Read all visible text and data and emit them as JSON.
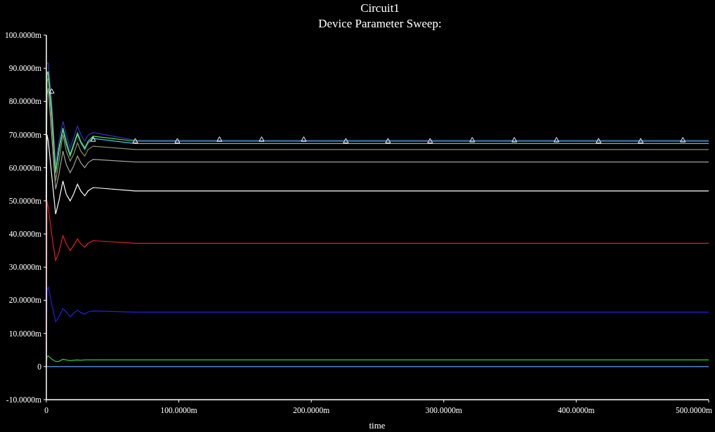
{
  "graph": {
    "circuit": "Circuit1",
    "chart_data": {
      "type": "line",
      "title": "Device Parameter Sweep:",
      "xlabel": "time",
      "x": [
        0,
        0.5,
        1.5,
        4,
        7,
        9.5,
        12.5,
        15,
        18,
        20.5,
        23.5,
        26,
        29,
        31.5,
        35.3,
        67.1,
        98.9,
        130.7,
        162.5,
        194.3,
        226.1,
        257.9,
        289.7,
        321.5,
        353.3,
        385.1,
        416.9,
        448.7,
        480.5,
        500
      ],
      "xlim": [
        0,
        500
      ],
      "ylim": [
        -10,
        100
      ],
      "xticks": [
        {
          "value": 0,
          "label": "0"
        },
        {
          "value": 100,
          "label": "100.0000m"
        },
        {
          "value": 200,
          "label": "200.0000m"
        },
        {
          "value": 300,
          "label": "300.0000m"
        },
        {
          "value": 400,
          "label": "400.0000m"
        },
        {
          "value": 500,
          "label": "500.0000m"
        }
      ],
      "yticks": [
        {
          "value": -10,
          "label": "-10.0000m"
        },
        {
          "value": 0,
          "label": "0"
        },
        {
          "value": 10,
          "label": "10.0000m"
        },
        {
          "value": 20,
          "label": "20.0000m"
        },
        {
          "value": 30,
          "label": "30.0000m"
        },
        {
          "value": 40,
          "label": "40.0000m"
        },
        {
          "value": 50,
          "label": "50.0000m"
        },
        {
          "value": 60,
          "label": "60.0000m"
        },
        {
          "value": 70,
          "label": "70.0000m"
        },
        {
          "value": 80,
          "label": "80.0000m"
        },
        {
          "value": 90,
          "label": "90.0000m"
        },
        {
          "value": 100,
          "label": "100.0000m"
        }
      ],
      "series": [
        {
          "color": "#60a0ff",
          "values": [
            0,
            0,
            0,
            0,
            0,
            0,
            0,
            0,
            0,
            0,
            0,
            0,
            0,
            0,
            0,
            0,
            0,
            0,
            0,
            0,
            0,
            0,
            0,
            0,
            0,
            0,
            0,
            0,
            0,
            0
          ]
        },
        {
          "color": "#30d030",
          "values": [
            0,
            3,
            3.2,
            2.3,
            1.5,
            1.6,
            2.2,
            2,
            1.8,
            1.9,
            2,
            1.9,
            2,
            2,
            2,
            2,
            2,
            2,
            2,
            2,
            2,
            2,
            2,
            2,
            2,
            2,
            2,
            2,
            2,
            2
          ]
        },
        {
          "color": "#2020e0",
          "values": [
            0,
            23,
            24,
            19,
            13.5,
            15,
            17.5,
            16.5,
            15,
            16,
            17,
            16.3,
            15.8,
            16.5,
            16.8,
            16.4,
            16.4,
            16.4,
            16.4,
            16.4,
            16.4,
            16.4,
            16.4,
            16.4,
            16.4,
            16.4,
            16.4,
            16.4,
            16.4,
            16.4
          ]
        },
        {
          "color": "#e02020",
          "values": [
            0,
            50,
            48,
            40,
            32,
            34.5,
            39.5,
            37,
            35,
            36.5,
            38.5,
            37,
            36,
            37.2,
            38,
            37.2,
            37.2,
            37.2,
            37.2,
            37.2,
            37.2,
            37.2,
            37.2,
            37.2,
            37.2,
            37.2,
            37.2,
            37.2,
            37.2,
            37.2
          ]
        },
        {
          "color": "#ffffff",
          "values": [
            50,
            70,
            68,
            58,
            46,
            50,
            56,
            52,
            50,
            52,
            55,
            53,
            51.5,
            53,
            54,
            53,
            53,
            53,
            53,
            53,
            53,
            53,
            53,
            53,
            53,
            53,
            53,
            53,
            53,
            53
          ]
        },
        {
          "color": "#a0a0a0",
          "values": [
            60,
            82,
            84,
            70,
            53.5,
            58,
            65,
            61,
            58.5,
            60.5,
            63.5,
            61.5,
            60,
            61.5,
            62.5,
            61.7,
            61.7,
            61.7,
            61.7,
            61.7,
            61.7,
            61.7,
            61.7,
            61.7,
            61.7,
            61.7,
            61.7,
            61.7,
            61.7,
            61.7
          ]
        },
        {
          "color": "#909050",
          "values": [
            65,
            86,
            87,
            74,
            56,
            62,
            70,
            65,
            62,
            64,
            67.5,
            65,
            63.5,
            65.5,
            66.5,
            65.5,
            65.5,
            65.5,
            65.5,
            65.5,
            65.5,
            65.5,
            65.5,
            65.5,
            65.5,
            65.5,
            65.5,
            65.5,
            65.5,
            65.5
          ]
        },
        {
          "color": "#40c8e8",
          "values": [
            null,
            89,
            88,
            77,
            58.5,
            65,
            71.5,
            67,
            63.5,
            66.5,
            70,
            67.5,
            65.5,
            67.5,
            68.8,
            67.3,
            67.3,
            67.3,
            67.3,
            67.3,
            67.3,
            67.3,
            67.3,
            67.3,
            67.3,
            67.3,
            67.3,
            67.3,
            67.3,
            67.3
          ]
        },
        {
          "color": "#3030c0",
          "values": [
            null,
            91.5,
            91.5,
            80,
            61,
            68,
            74,
            70,
            66,
            69,
            72.5,
            70,
            68,
            69.8,
            70.6,
            68.3,
            68.3,
            68.3,
            68.3,
            68.3,
            68.3,
            68.3,
            68.3,
            68.3,
            68.3,
            68.3,
            68.3,
            68.3,
            68.3,
            68.3
          ]
        },
        {
          "color": "#60e060",
          "values": [
            70,
            88,
            89,
            78,
            59,
            66,
            72,
            68,
            64,
            67,
            70.5,
            68,
            66,
            68,
            69.5,
            68,
            68,
            68,
            68,
            68,
            68,
            68,
            68,
            68,
            68,
            68,
            68,
            68,
            68,
            68
          ]
        },
        {
          "type": "scatter",
          "color": "#ffffff",
          "values": [
            null,
            null,
            null,
            83,
            null,
            null,
            null,
            null,
            null,
            null,
            null,
            null,
            null,
            null,
            68.5,
            68,
            68,
            68.5,
            68.5,
            68.5,
            68,
            68,
            68,
            68.3,
            68.3,
            68.3,
            68,
            68,
            68.3,
            null
          ]
        }
      ]
    }
  }
}
